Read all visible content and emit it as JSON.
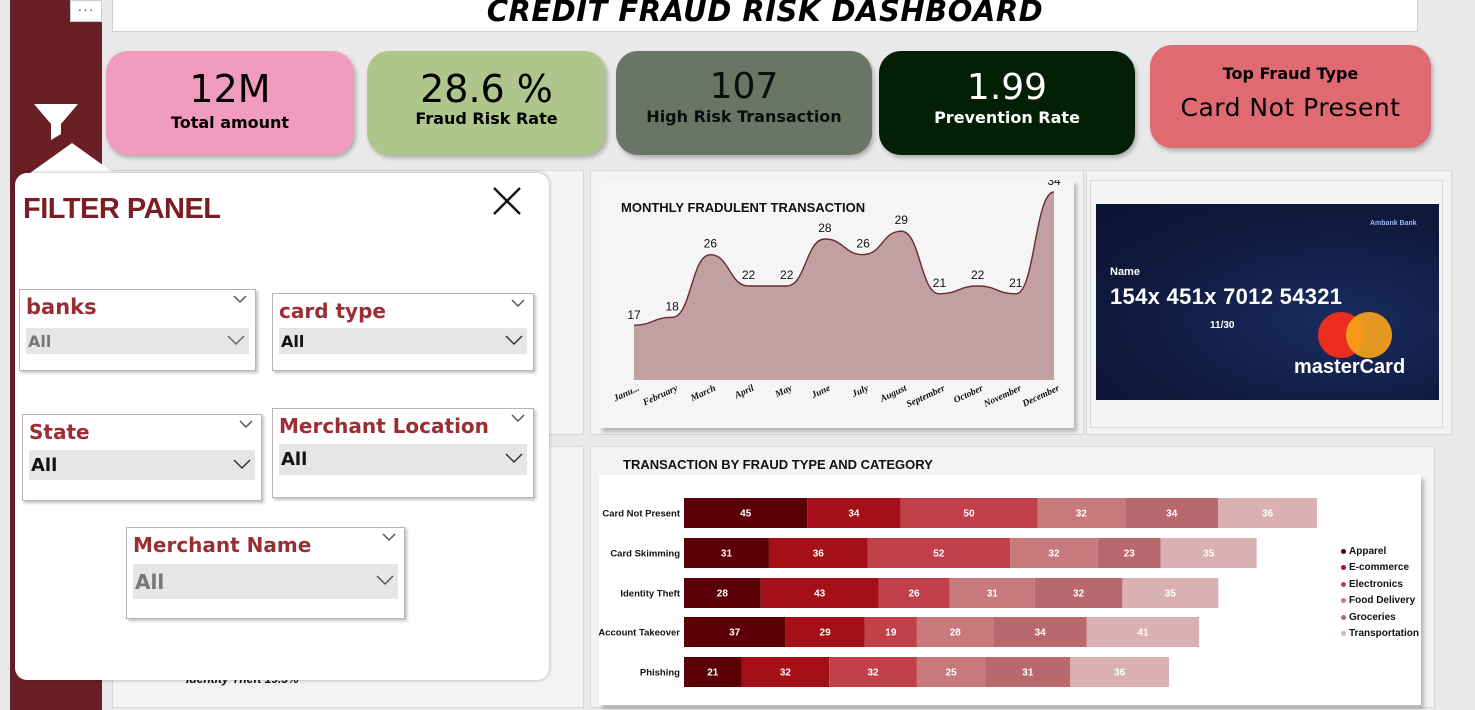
{
  "app": {
    "title": "CREDIT FRAUD RISK DASHBOARD",
    "more_options": "···"
  },
  "kpis": [
    {
      "value": "12M",
      "label": "Total amount"
    },
    {
      "value": "28.6 %",
      "label": "Fraud Risk Rate"
    },
    {
      "value": "107",
      "label": "High Risk Transaction"
    },
    {
      "value": "1.99",
      "label": "Prevention Rate"
    },
    {
      "label": "Top Fraud Type",
      "value": "Card Not Present"
    }
  ],
  "monthly_chart": {
    "title": "MONTHLY FRADULENT TRANSACTION"
  },
  "card": {
    "bank": "Ambank Bank",
    "name_label": "Name",
    "number": "154x 451x 7012  54321",
    "expiry": "11/30",
    "brand": "masterCard"
  },
  "fraud_chart": {
    "title": "TRANSACTION BY FRAUD TYPE AND CATEGORY",
    "colors": [
      "#5c0008",
      "#a50f17",
      "#c2404a",
      "#c8797c",
      "#b9686d",
      "#d9b1b2"
    ]
  },
  "chart_data": [
    {
      "type": "area",
      "title": "MONTHLY FRADULENT TRANSACTION",
      "categories": [
        "Janu...",
        "February",
        "March",
        "April",
        "May",
        "June",
        "July",
        "August",
        "September",
        "October",
        "November",
        "December"
      ],
      "values": [
        17,
        18,
        26,
        22,
        22,
        28,
        26,
        29,
        21,
        22,
        21,
        34
      ],
      "ylim": [
        10,
        34
      ],
      "grid": false
    },
    {
      "type": "bar",
      "orientation": "horizontal-stacked",
      "title": "TRANSACTION BY FRAUD TYPE AND CATEGORY",
      "categories": [
        "Card Not Present",
        "Card Skimming",
        "Identity Theft",
        "Account Takeover",
        "Phishing"
      ],
      "series": [
        {
          "name": "Apparel",
          "values": [
            45,
            31,
            28,
            37,
            21
          ]
        },
        {
          "name": "E-commerce",
          "values": [
            34,
            36,
            43,
            29,
            32
          ]
        },
        {
          "name": "Electronics",
          "values": [
            50,
            52,
            26,
            19,
            32
          ]
        },
        {
          "name": "Food Delivery",
          "values": [
            32,
            32,
            31,
            28,
            25
          ]
        },
        {
          "name": "Groceries",
          "values": [
            34,
            23,
            32,
            34,
            31
          ]
        },
        {
          "name": "Transportation",
          "values": [
            36,
            35,
            35,
            41,
            36
          ]
        }
      ],
      "legend_position": "right"
    }
  ],
  "filter_panel": {
    "title": "FILTER PANEL",
    "slicers": {
      "banks": {
        "label": "banks",
        "value": "All"
      },
      "card_type": {
        "label": "card type",
        "value": "All"
      },
      "state": {
        "label": "State",
        "value": "All"
      },
      "merchant_location": {
        "label": "Merchant Location",
        "value": "All"
      },
      "merchant_name": {
        "label": "Merchant Name",
        "value": "All"
      }
    }
  },
  "obscured_text": "Identity Theft 19.3%"
}
